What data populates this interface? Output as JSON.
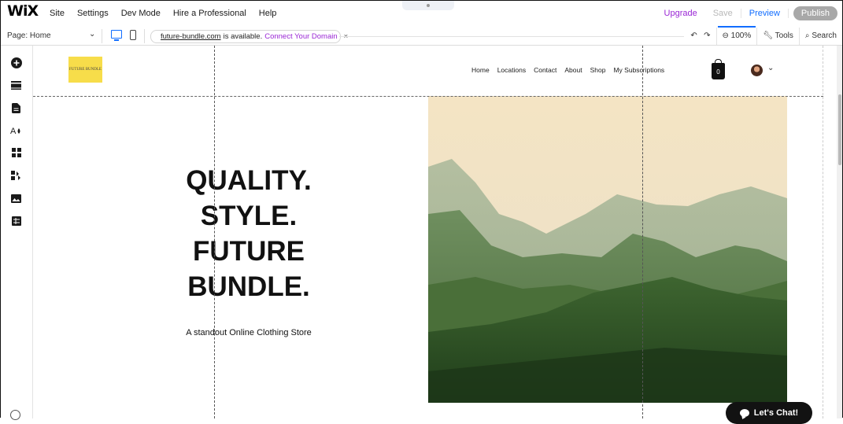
{
  "topbar": {
    "logo": "WiX",
    "menu": [
      "Site",
      "Settings",
      "Dev Mode",
      "Hire a Professional",
      "Help"
    ],
    "upgrade": "Upgrade",
    "save": "Save",
    "preview": "Preview",
    "publish": "Publish"
  },
  "subbar": {
    "page": "Page: Home",
    "domain": "future-bundle.com",
    "available": "is available.",
    "connect": "Connect Your Domain",
    "close": "×",
    "zoom": "100%",
    "tools": "Tools",
    "search": "Search"
  },
  "site": {
    "logo_text": "FUTURE BUNDLE",
    "nav": [
      "Home",
      "Locations",
      "Contact",
      "About",
      "Shop",
      "My Subscriptions"
    ],
    "cart_count": "0",
    "hero": [
      "QUALITY.",
      "STYLE.",
      "FUTURE",
      "BUNDLE."
    ],
    "tagline": "A standout Online Clothing Store",
    "chat": "Let's Chat!"
  },
  "colors": {
    "accent": "#116dff",
    "upgrade": "#9a27d5",
    "logo_bg": "#f7dd4a"
  }
}
